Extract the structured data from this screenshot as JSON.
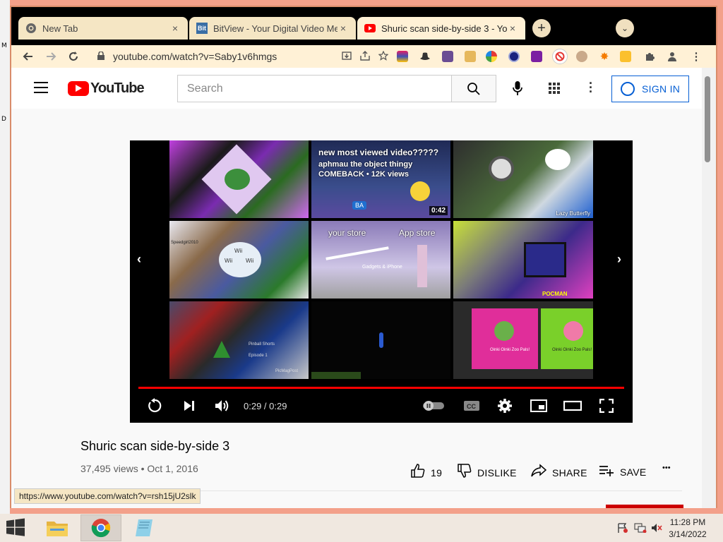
{
  "desktop": {
    "edge_letters": [
      "M",
      "D"
    ]
  },
  "browser": {
    "tabs": [
      {
        "title": "New Tab",
        "icon": "chrome-icon",
        "close": "×"
      },
      {
        "title": "BitView - Your Digital Video Megaplex",
        "icon": "bitview-icon",
        "favicon_text": "Bit",
        "close": "×"
      },
      {
        "title": "Shuric scan side-by-side 3 - YouTube",
        "icon": "youtube-icon",
        "close": "×"
      }
    ],
    "new_tab": "+",
    "tab_menu": "⌄",
    "url": "youtube.com/watch?v=Saby1v6hmgs",
    "status_url": "https://www.youtube.com/watch?v=rsh15jU2slk"
  },
  "youtube": {
    "logo_text": "YouTube",
    "search_placeholder": "Search",
    "sign_in": "SIGN IN"
  },
  "player": {
    "tiles": {
      "t2_line1": "new most viewed video?????",
      "t2_line2": "aphmau the object thingy",
      "t2_line3": "COMEBACK • 12K views",
      "t2_duration": "0:42",
      "t3_caption": "Lazy Butterfly",
      "t5_left": "your store",
      "t5_right": "App store",
      "t5_caption": "Gadgets & iPhone",
      "t4_labels": [
        "Wii",
        "Wii",
        "Wii"
      ],
      "t4_name": "Speedgirl2010",
      "t7_labels": [
        "Pinball Shorts",
        "Episode 1",
        "PicMagPost"
      ],
      "t9_labels": [
        "Oinki Oinki Zoo Pals!",
        "Oinki Oinki Zoo Pals!"
      ],
      "t6_caption": "POCMAN",
      "t2_badge": "BA"
    },
    "time": "0:29 / 0:29",
    "progress": 1.0,
    "prev": "‹",
    "next": "›"
  },
  "video": {
    "title": "Shuric scan side-by-side 3",
    "views_date": "37,495 views • Oct 1, 2016",
    "likes": "19",
    "dislike": "DISLIKE",
    "share": "SHARE",
    "save": "SAVE",
    "more": "•••"
  },
  "taskbar": {
    "time": "11:28 PM",
    "date": "3/14/2022"
  },
  "colors": {
    "accent": "#ff0000",
    "link": "#065fd4",
    "tab_bg": "#f5e6c4",
    "toolbar_bg": "#fff1d6"
  }
}
